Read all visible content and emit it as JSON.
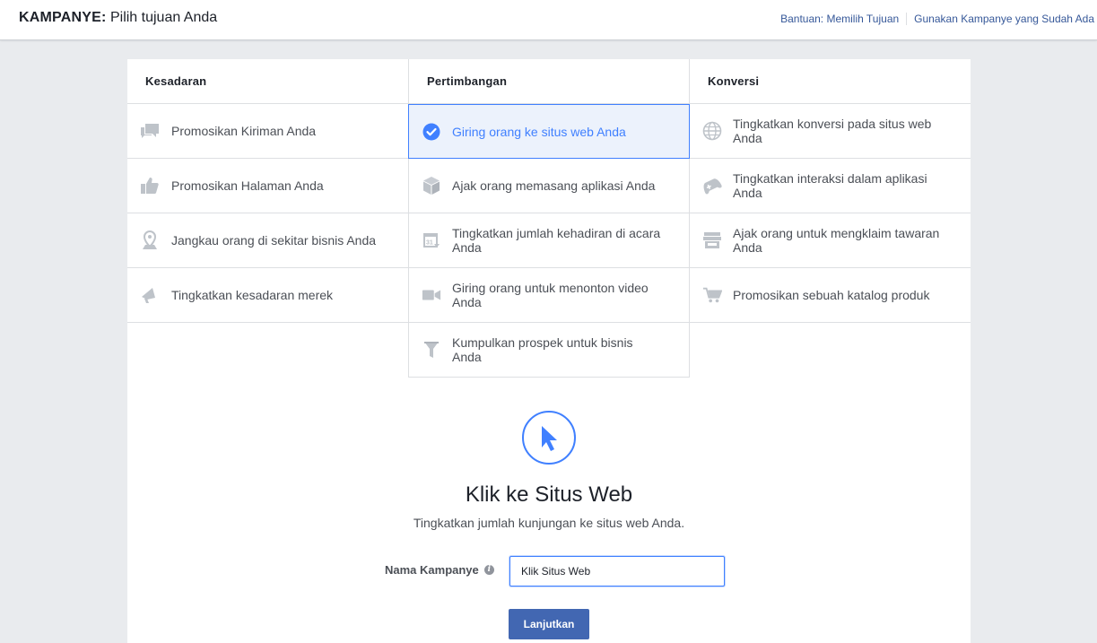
{
  "header": {
    "title_bold": "KAMPANYE:",
    "title_rest": "Pilih tujuan Anda",
    "link_help": "Bantuan: Memilih Tujuan",
    "link_existing": "Gunakan Kampanye yang Sudah Ada"
  },
  "columns": [
    {
      "heading": "Kesadaran",
      "items": [
        {
          "label": "Promosikan Kiriman Anda",
          "icon": "speech-bubbles-icon"
        },
        {
          "label": "Promosikan Halaman Anda",
          "icon": "thumbs-up-icon"
        },
        {
          "label": "Jangkau orang di sekitar bisnis Anda",
          "icon": "map-pin-icon"
        },
        {
          "label": "Tingkatkan kesadaran merek",
          "icon": "megaphone-icon"
        }
      ]
    },
    {
      "heading": "Pertimbangan",
      "items": [
        {
          "label": "Giring orang ke situs web Anda",
          "icon": "check-circle-icon",
          "selected": true
        },
        {
          "label": "Ajak orang memasang aplikasi Anda",
          "icon": "cube-icon"
        },
        {
          "label": "Tingkatkan jumlah kehadiran di acara Anda",
          "icon": "calendar-icon"
        },
        {
          "label": "Giring orang untuk menonton video Anda",
          "icon": "video-camera-icon"
        },
        {
          "label": "Kumpulkan prospek untuk bisnis Anda",
          "icon": "funnel-icon"
        }
      ]
    },
    {
      "heading": "Konversi",
      "items": [
        {
          "label": "Tingkatkan konversi pada situs web Anda",
          "icon": "globe-icon"
        },
        {
          "label": "Tingkatkan interaksi dalam aplikasi Anda",
          "icon": "gamepad-icon"
        },
        {
          "label": "Ajak orang untuk mengklaim tawaran Anda",
          "icon": "storefront-icon"
        },
        {
          "label": "Promosikan sebuah katalog produk",
          "icon": "shopping-cart-icon"
        }
      ]
    }
  ],
  "detail": {
    "title": "Klik ke Situs Web",
    "subtitle": "Tingkatkan jumlah kunjungan ke situs web Anda.",
    "name_label": "Nama Kampanye",
    "name_value": "Klik Situs Web",
    "continue_label": "Lanjutkan",
    "icon": "cursor-arrow-icon"
  },
  "colors": {
    "accent": "#4080ff",
    "button": "#4267b2",
    "icon_gray": "#bec3c9",
    "selected_bg": "#ecf2fc"
  }
}
